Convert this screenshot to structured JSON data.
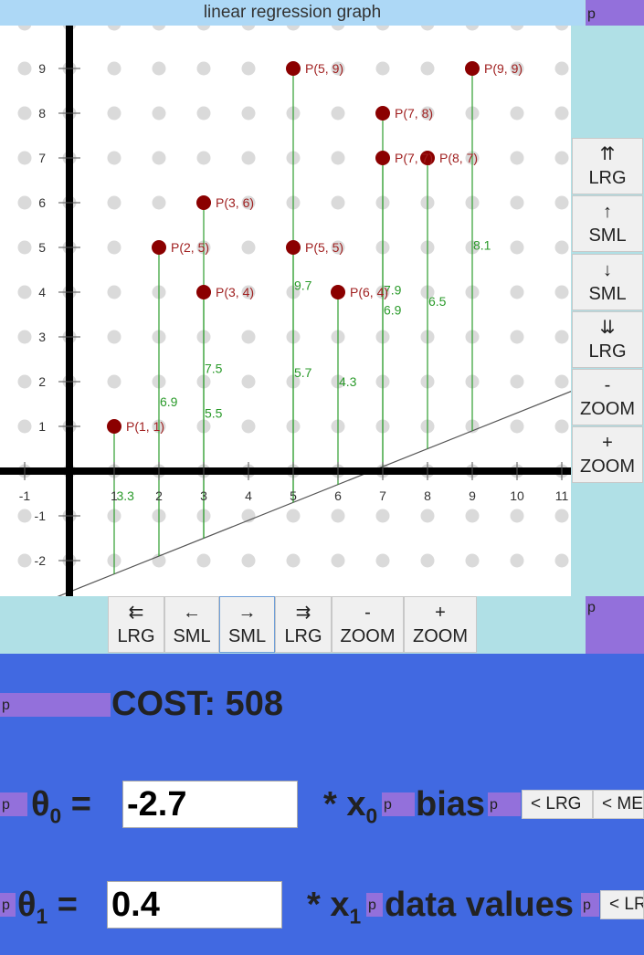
{
  "title": "linear regression graph",
  "p_tag": "p",
  "graph": {
    "x_ticks": [
      "-1",
      "1",
      "2",
      "3",
      "4",
      "5",
      "6",
      "7",
      "8",
      "9",
      "10",
      "11"
    ],
    "y_ticks": [
      "9",
      "8",
      "7",
      "6",
      "5",
      "4",
      "3",
      "2",
      "1",
      "-1",
      "-2"
    ],
    "points": [
      {
        "label": "P(1, 1)",
        "x": 1,
        "y": 1
      },
      {
        "label": "P(2, 5)",
        "x": 2,
        "y": 5
      },
      {
        "label": "P(3, 4)",
        "x": 3,
        "y": 4
      },
      {
        "label": "P(3, 6)",
        "x": 3,
        "y": 6
      },
      {
        "label": "P(5, 5)",
        "x": 5,
        "y": 5
      },
      {
        "label": "P(5, 9)",
        "x": 5,
        "y": 9
      },
      {
        "label": "P(6, 4)",
        "x": 6,
        "y": 4
      },
      {
        "label": "P(7, 7)",
        "x": 7,
        "y": 7
      },
      {
        "label": "P(7, 8)",
        "x": 7,
        "y": 8
      },
      {
        "label": "P(8, 7)",
        "x": 8,
        "y": 7
      },
      {
        "label": "P(9, 9)",
        "x": 9,
        "y": 9
      }
    ],
    "errors": [
      {
        "text": "3.3",
        "x": 1.03,
        "y": -0.55
      },
      {
        "text": "6.9",
        "x": 2.0,
        "y": 1.55
      },
      {
        "text": "7.5",
        "x": 3.0,
        "y": 2.3
      },
      {
        "text": "5.5",
        "x": 3.0,
        "y": 1.3
      },
      {
        "text": "9.7",
        "x": 5.0,
        "y": 4.15
      },
      {
        "text": "5.7",
        "x": 5.0,
        "y": 2.2
      },
      {
        "text": "4.3",
        "x": 6.0,
        "y": 2.0
      },
      {
        "text": "7.9",
        "x": 7.0,
        "y": 4.05
      },
      {
        "text": "6.9",
        "x": 7.0,
        "y": 3.6
      },
      {
        "text": "6.5",
        "x": 8.0,
        "y": 3.8
      },
      {
        "text": "8.1",
        "x": 9.0,
        "y": 5.05
      }
    ],
    "line": {
      "theta0": -2.7,
      "theta1": 0.4
    }
  },
  "vertical_buttons": [
    {
      "arrow": "⇈",
      "label": "LRG"
    },
    {
      "arrow": "↑",
      "label": "SML"
    },
    {
      "arrow": "↓",
      "label": "SML"
    },
    {
      "arrow": "⇊",
      "label": "LRG"
    },
    {
      "arrow": "-",
      "label": "ZOOM"
    },
    {
      "arrow": "+",
      "label": "ZOOM"
    }
  ],
  "horizontal_buttons": [
    {
      "arrow": "⇇",
      "label": "LRG"
    },
    {
      "arrow": "←",
      "label": "SML"
    },
    {
      "arrow": "→",
      "label": "SML"
    },
    {
      "arrow": "⇉",
      "label": "LRG"
    },
    {
      "arrow": "-",
      "label": "ZOOM"
    },
    {
      "arrow": "+",
      "label": "ZOOM"
    }
  ],
  "cost_text": "COST: 508",
  "theta0": {
    "symbol": "θ",
    "sub": "0",
    "eq": " =",
    "value": "-2.7",
    "times": "* x",
    "xsub": "0",
    "name": "bias",
    "btn1": "< LRG",
    "btn2": "< ME"
  },
  "theta1": {
    "symbol": "θ",
    "sub": "1",
    "eq": " =",
    "value": "0.4",
    "times": "* x",
    "xsub": "1",
    "name": "data values",
    "btn1": "< LR"
  }
}
